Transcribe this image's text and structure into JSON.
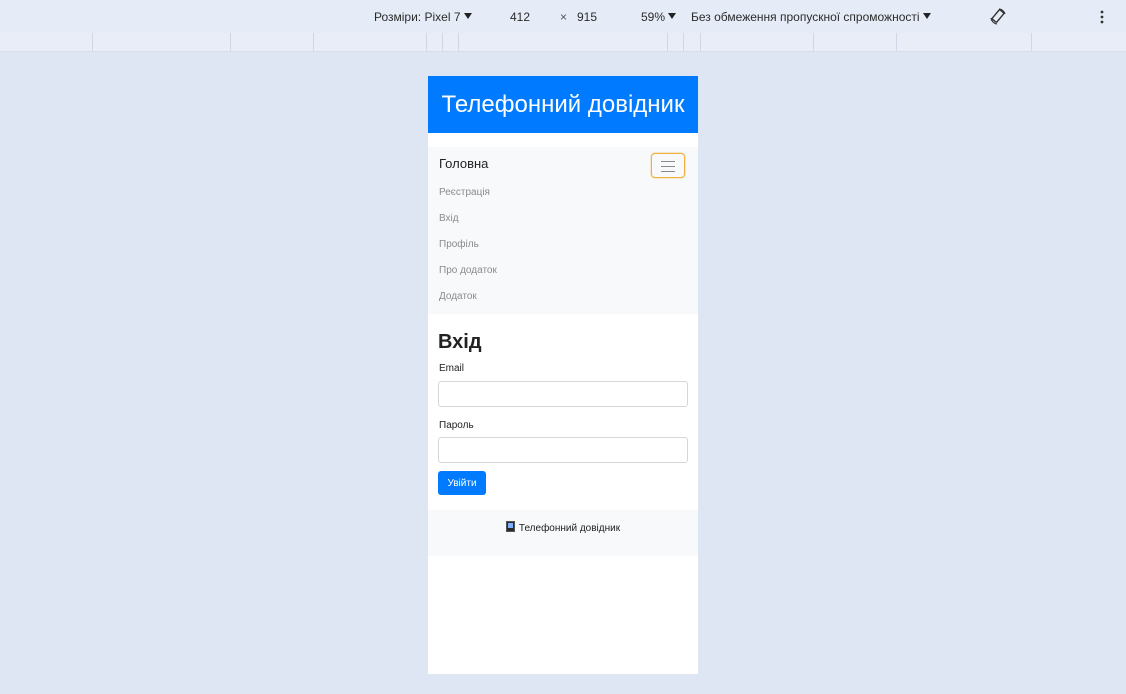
{
  "devtools": {
    "dimensions_label": "Розміри: Pixel 7",
    "width": "412",
    "times": "×",
    "height": "915",
    "zoom": "59%",
    "throttle": "Без обмеження пропускної спроможності",
    "rotate_icon": "rotate-icon",
    "more_icon": "more-vertical-icon"
  },
  "app": {
    "header_title": "Телефонний довідник",
    "navbar": {
      "brand": "Головна",
      "items": [
        {
          "label": "Реєстрація"
        },
        {
          "label": "Вхід"
        },
        {
          "label": "Профіль"
        },
        {
          "label": "Про додаток"
        },
        {
          "label": "Додаток"
        }
      ]
    },
    "login": {
      "title": "Вхід",
      "email_label": "Email",
      "email_value": "",
      "password_label": "Пароль",
      "password_value": "",
      "submit_label": "Увійти"
    },
    "footer": {
      "text": "Телефонний довідник"
    }
  }
}
